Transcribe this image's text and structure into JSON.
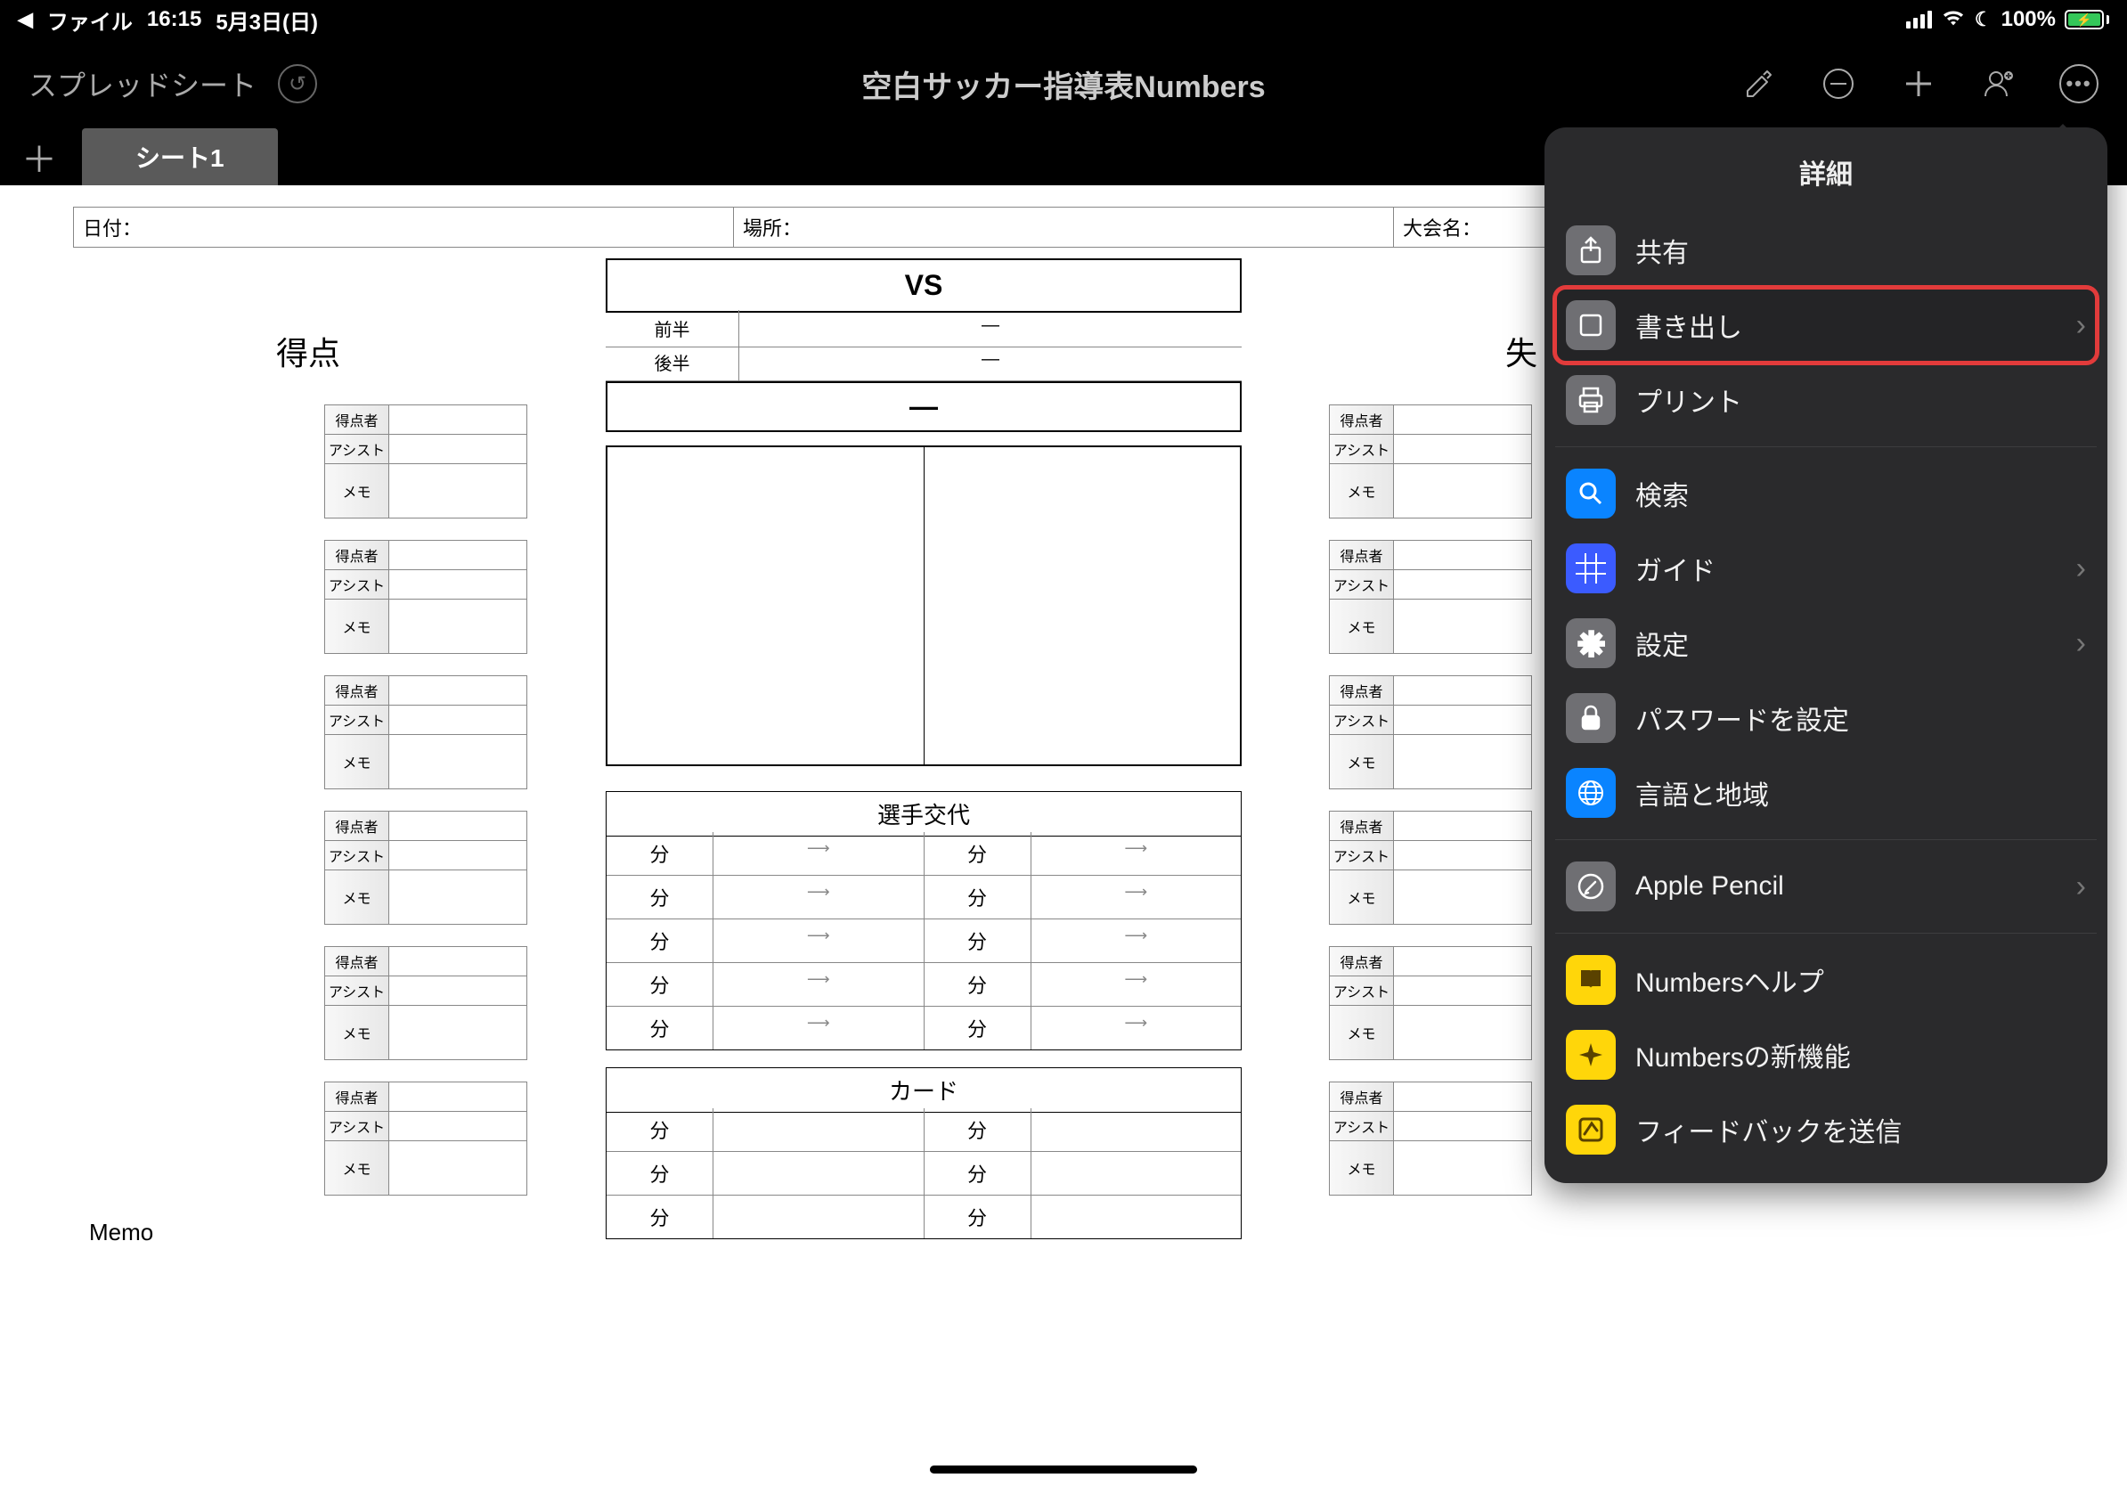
{
  "status": {
    "back_app": "ファイル",
    "time": "16:15",
    "date": "5月3日(日)",
    "battery_pct": "100%"
  },
  "titlebar": {
    "back_label": "スプレッドシート",
    "doc_title": "空白サッカー指導表Numbers"
  },
  "tabs": {
    "sheet1": "シート1"
  },
  "info": {
    "date": "日付：",
    "place": "場所：",
    "event": "大会名："
  },
  "vs": "VS",
  "halves": {
    "first": "前半",
    "second": "後半",
    "dash": "—"
  },
  "headings": {
    "goals": "得点",
    "lost": "失",
    "memo": "Memo"
  },
  "card_labels": {
    "scorer": "得点者",
    "assist": "アシスト",
    "memo": "メモ"
  },
  "sub": {
    "title": "選手交代",
    "min": "分",
    "arrow": "⟶"
  },
  "cards_section": {
    "title": "カード",
    "min": "分"
  },
  "popup": {
    "title": "詳細",
    "share": "共有",
    "export": "書き出し",
    "print": "プリント",
    "search": "検索",
    "guide": "ガイド",
    "settings": "設定",
    "password": "パスワードを設定",
    "language": "言語と地域",
    "pencil": "Apple Pencil",
    "help": "Numbersヘルプ",
    "whatsnew": "Numbersの新機能",
    "feedback": "フィードバックを送信"
  }
}
